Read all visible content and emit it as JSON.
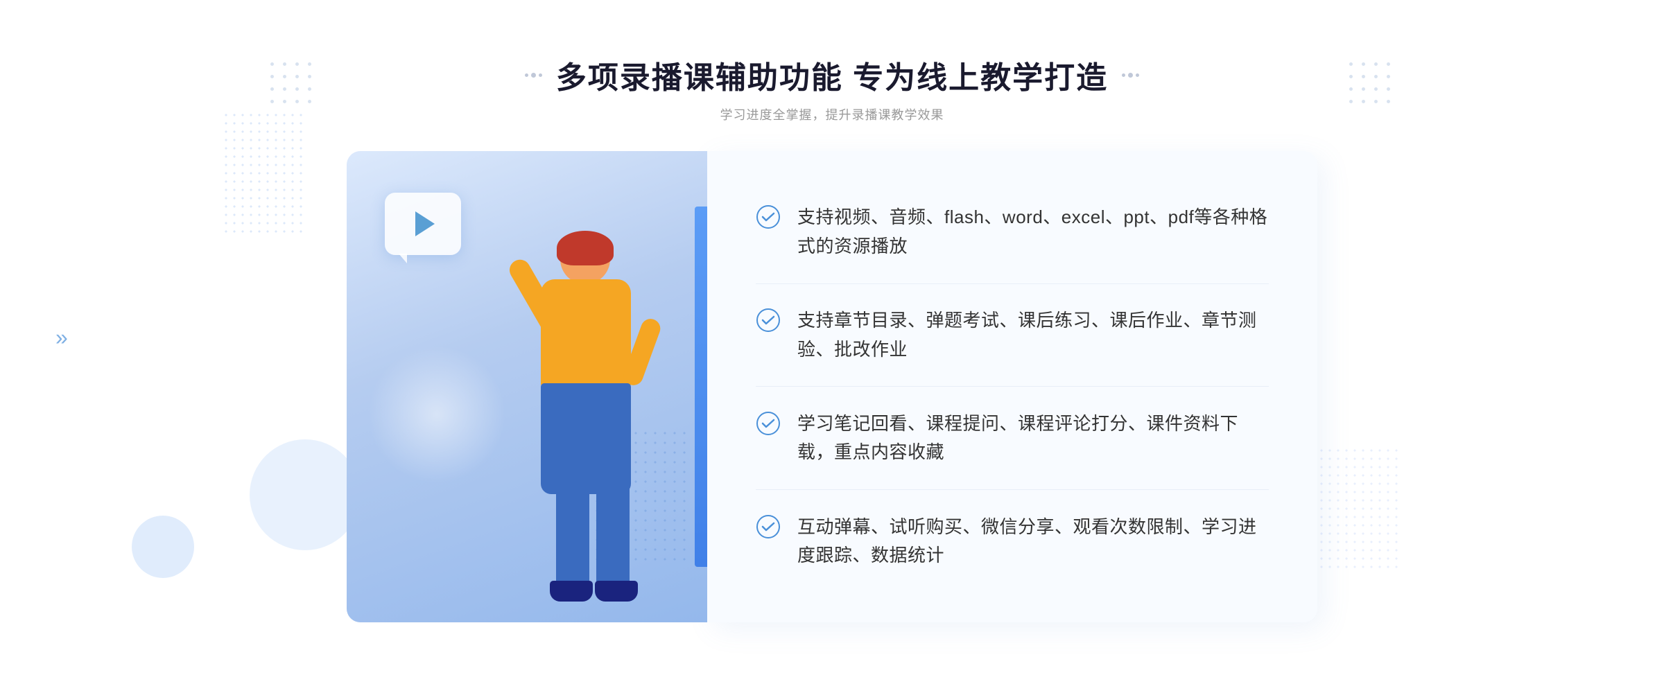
{
  "page": {
    "background": "#ffffff"
  },
  "header": {
    "title": "多项录播课辅助功能 专为线上教学打造",
    "subtitle": "学习进度全掌握，提升录播课教学效果"
  },
  "features": [
    {
      "id": "feature-1",
      "text": "支持视频、音频、flash、word、excel、ppt、pdf等各种格式的资源播放"
    },
    {
      "id": "feature-2",
      "text": "支持章节目录、弹题考试、课后练习、课后作业、章节测验、批改作业"
    },
    {
      "id": "feature-3",
      "text": "学习笔记回看、课程提问、课程评论打分、课件资料下载，重点内容收藏"
    },
    {
      "id": "feature-4",
      "text": "互动弹幕、试听购买、微信分享、观看次数限制、学习进度跟踪、数据统计"
    }
  ],
  "icons": {
    "check_color": "#4a90d9",
    "chevron": "»"
  }
}
